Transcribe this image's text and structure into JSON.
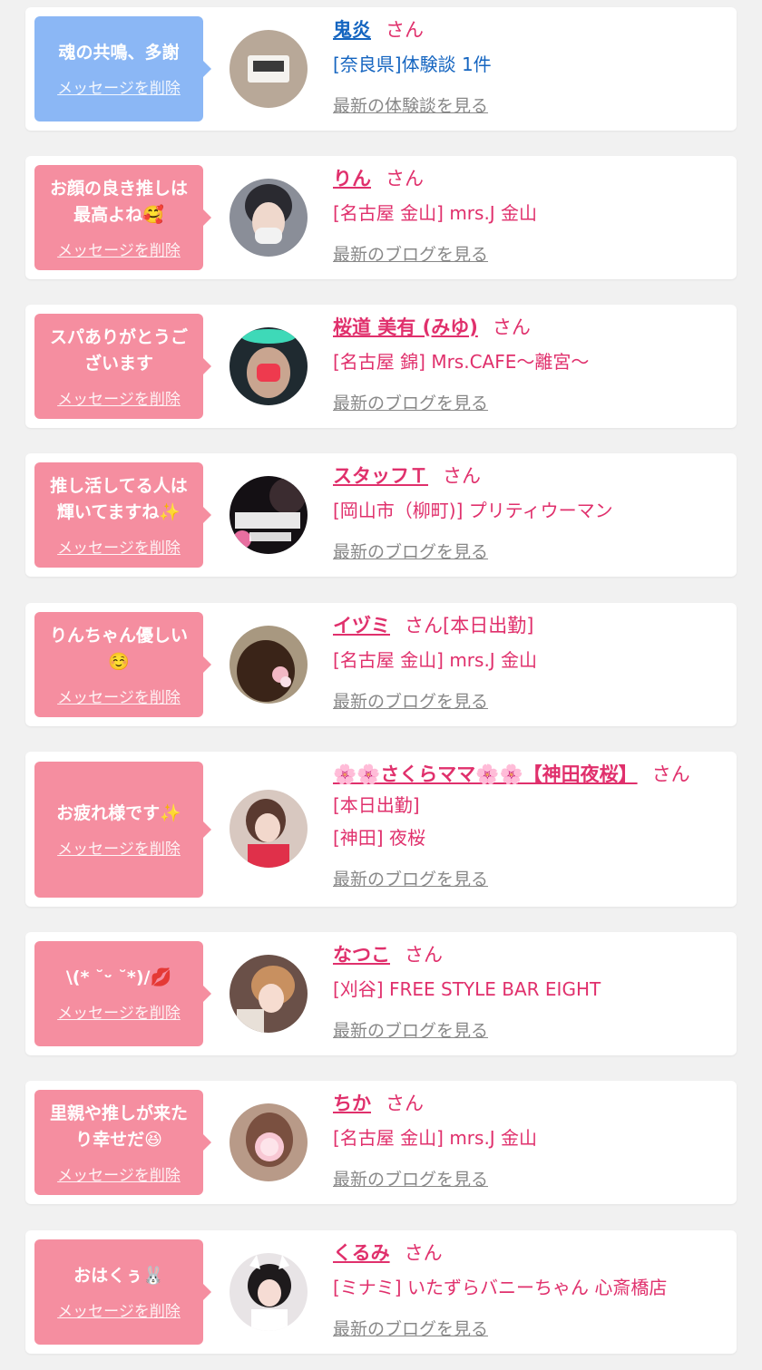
{
  "delete_label": "メッセージを削除",
  "san_label": "さん",
  "colors": {
    "blue_bubble": "#8bb7f5",
    "pink_bubble": "#f58ea0",
    "pink_text": "#e0306c",
    "blue_text": "#1565c0"
  },
  "cards": [
    {
      "message": "魂の共鳴、多謝",
      "name": "鬼炎",
      "suffix": "",
      "details": [
        "[奈良県]体験談 1件"
      ],
      "link": "最新の体験談を見る",
      "avatar": "clock-photo-avatar"
    },
    {
      "message": "お顔の良き推しは最高よね🥰",
      "name": "りん",
      "suffix": "",
      "details": [
        "[名古屋 金山] mrs.J 金山"
      ],
      "link": "最新のブログを見る",
      "avatar": "person-photo-avatar"
    },
    {
      "message": "スパありがとうございます",
      "name": "桜道 美有 (みゆ)",
      "suffix": "",
      "details": [
        "[名古屋 錦] Mrs.CAFE〜離宮〜"
      ],
      "link": "最新のブログを見る",
      "avatar": "person-photo-avatar"
    },
    {
      "message": "推し活してる人は輝いてますね✨",
      "name": "スタッフＴ",
      "suffix": "",
      "details": [
        "[岡山市（柳町)] プリティウーマン"
      ],
      "link": "最新のブログを見る",
      "avatar": "shop-logo-avatar"
    },
    {
      "message": "りんちゃん優しい☺️",
      "name": "イヅミ",
      "suffix": "[本日出勤]",
      "details": [
        "[名古屋 金山] mrs.J 金山"
      ],
      "link": "最新のブログを見る",
      "avatar": "hair-photo-avatar"
    },
    {
      "message": "お疲れ様です✨",
      "name": "🌸🌸さくらママ🌸🌸【神田夜桜】",
      "suffix": "",
      "details": [
        "[本日出勤]",
        "[神田] 夜桜"
      ],
      "link": "最新のブログを見る",
      "avatar": "person-photo-avatar"
    },
    {
      "message": "\\(* ˘ᵕ ˘*)/💋",
      "name": "なつこ",
      "suffix": "",
      "details": [
        "[刈谷] FREE STYLE BAR EIGHT"
      ],
      "link": "最新のブログを見る",
      "avatar": "person-photo-avatar"
    },
    {
      "message": "里親や推しが来たり幸せだ😆",
      "name": "ちか",
      "suffix": "",
      "details": [
        "[名古屋 金山] mrs.J 金山"
      ],
      "link": "最新のブログを見る",
      "avatar": "person-photo-avatar"
    },
    {
      "message": "おはくぅ🐰",
      "name": "くるみ",
      "suffix": "",
      "details": [
        "[ミナミ] いたずらバニーちゃん 心斎橋店"
      ],
      "link": "最新のブログを見る",
      "avatar": "person-photo-avatar"
    }
  ]
}
